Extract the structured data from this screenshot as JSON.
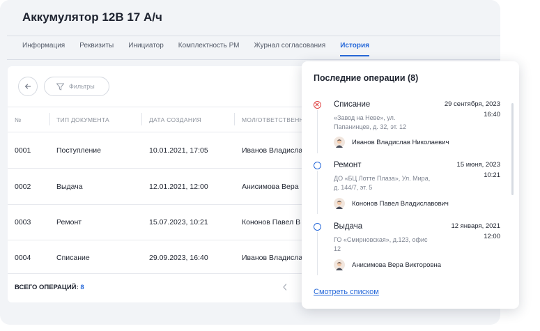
{
  "title": "Аккумулятор 12В 17 А/ч",
  "tabs": [
    {
      "label": "Информация"
    },
    {
      "label": "Реквизиты"
    },
    {
      "label": "Инициатор"
    },
    {
      "label": "Комплектность РМ"
    },
    {
      "label": "Журнал согласования"
    },
    {
      "label": "История",
      "active": true
    }
  ],
  "toolbar": {
    "back_icon": "arrow-left-icon",
    "filter_icon": "funnel-icon",
    "filter_label": "Фильтры"
  },
  "table": {
    "headers": [
      "№",
      "ТИП ДОКУМЕНТА",
      "ДАТА СОЗДАНИЯ",
      "МОЛ/ОТВЕТСТВЕНН"
    ],
    "rows": [
      {
        "num": "0001",
        "type": "Поступление",
        "date": "10.01.2021, 17:05",
        "person": "Иванов Владисла"
      },
      {
        "num": "0002",
        "type": "Выдача",
        "date": "12.01.2021, 12:00",
        "person": "Анисимова Вера"
      },
      {
        "num": "0003",
        "type": "Ремонт",
        "date": "15.07.2023, 10:21",
        "person": "Кононов Павел В"
      },
      {
        "num": "0004",
        "type": "Списание",
        "date": "29.09.2023, 16:40",
        "person": "Иванов Владисла"
      }
    ]
  },
  "footer": {
    "label": "ВСЕГО ОПЕРАЦИЙ:",
    "count": "8"
  },
  "popup": {
    "title": "Последние операции (8)",
    "events": [
      {
        "type": "Списание",
        "status": "cancel",
        "status_color": "#e04545",
        "address": "«Завод на Неве», ул. Папанинцев, д. 32, эт. 12",
        "date": "29 сентября, 2023",
        "time": "16:40",
        "person": "Иванов Владислав Николаевич"
      },
      {
        "type": "Ремонт",
        "status": "normal",
        "status_color": "#2769d9",
        "address": "ДО «БЦ Лотте Плаза», Ул. Мира, д. 144/7, эт. 5",
        "date": "15 июня, 2023",
        "time": "10:21",
        "person": "Кононов Павел Владиславович"
      },
      {
        "type": "Выдача",
        "status": "normal",
        "status_color": "#2769d9",
        "address": "ГО «Смирновская», д.123, офис 12",
        "date": "12 января, 2021",
        "time": "12:00",
        "person": "Анисимова Вера Викторовна"
      }
    ],
    "link": "Смотреть списком"
  },
  "colors": {
    "accent": "#2769d9",
    "danger": "#e04545",
    "text": "#1f2430",
    "muted": "#8c929c"
  }
}
